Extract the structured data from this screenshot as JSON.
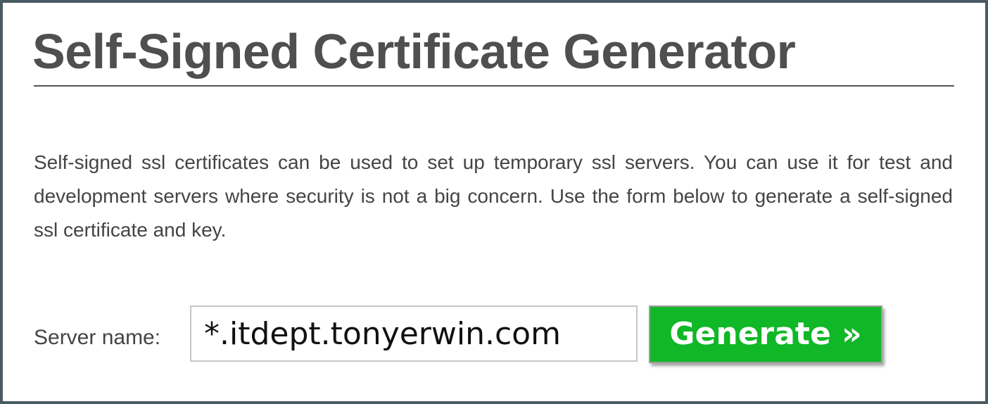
{
  "page": {
    "title": "Self-Signed Certificate Generator",
    "intro": "Self-signed ssl certificates can be used to set up temporary ssl servers. You can use it for test and development servers where security is not a big concern. Use the form below to generate a self-signed ssl certificate and key."
  },
  "form": {
    "server_label": "Server name:",
    "server_value": "*.itdept.tonyerwin.com",
    "generate_label": "Generate »"
  },
  "colors": {
    "button_green": "#10b727",
    "frame_border": "#4a5a63",
    "title_text": "#4f4f4f"
  }
}
